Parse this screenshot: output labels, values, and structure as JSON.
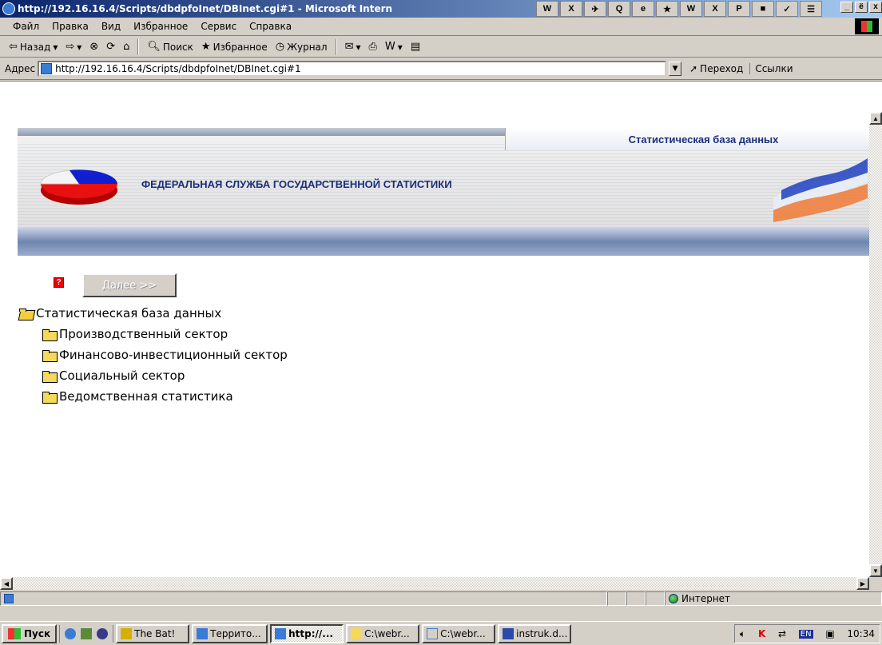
{
  "window": {
    "title": "http://192.16.16.4/Scripts/dbdpfoInet/DBInet.cgi#1 - Microsoft Intern",
    "minimize": "_",
    "maximize": "ё",
    "close": "x"
  },
  "quickbar": [
    "W",
    "X",
    "✈",
    "Q",
    "e",
    "★",
    "W",
    "X",
    "P",
    "■",
    "✓",
    "☰"
  ],
  "menu": [
    "Файл",
    "Правка",
    "Вид",
    "Избранное",
    "Сервис",
    "Справка"
  ],
  "toolbar": {
    "back": "Назад",
    "search": "Поиск",
    "favorites": "Избранное",
    "history": "Журнал"
  },
  "address": {
    "label": "Адрес",
    "url": "http://192.16.16.4/Scripts/dbdpfoInet/DBInet.cgi#1",
    "go": "Переход",
    "links": "Ссылки"
  },
  "banner": {
    "tab": "Статистическая база данных",
    "org": "ФЕДЕРАЛЬНАЯ СЛУЖБА ГОСУДАРСТВЕННОЙ СТАТИСТИКИ"
  },
  "controls": {
    "help": "?",
    "next": "Далее >>"
  },
  "tree": {
    "root": "Статистическая база данных",
    "items": [
      "Производственный сектор",
      "Финансово-инвестиционный сектор",
      "Социальный сектор",
      "Ведомственная статистика"
    ]
  },
  "status": {
    "zone": "Интернет"
  },
  "taskbar": {
    "start": "Пуск",
    "buttons": [
      "The Bat!",
      "Террито...",
      "http://...",
      "C:\\webr...",
      "C:\\webr...",
      "instruk.d..."
    ],
    "lang": "EN",
    "time": "10:34"
  }
}
